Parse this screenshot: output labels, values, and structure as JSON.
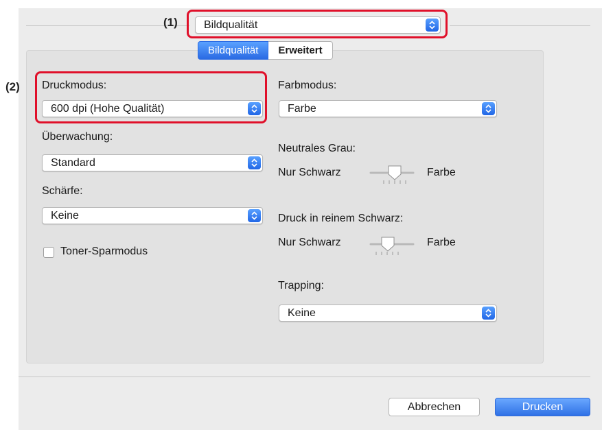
{
  "callouts": {
    "one": "(1)",
    "two": "(2)"
  },
  "panel_selector": {
    "value": "Bildqualität"
  },
  "tabs": [
    {
      "label": "Bildqualität",
      "active": true
    },
    {
      "label": "Erweitert",
      "active": false
    }
  ],
  "left": {
    "druckmodus_label": "Druckmodus:",
    "druckmodus_value": "600 dpi (Hohe Qualität)",
    "ueberwachung_label": "Überwachung:",
    "ueberwachung_value": "Standard",
    "schaerfe_label": "Schärfe:",
    "schaerfe_value": "Keine",
    "toner_label": "Toner-Sparmodus",
    "toner_checked": false
  },
  "right": {
    "farbmodus_label": "Farbmodus:",
    "farbmodus_value": "Farbe",
    "neutral_label": "Neutrales Grau:",
    "neutral_left": "Nur Schwarz",
    "neutral_right": "Farbe",
    "neutral_level": 0.5,
    "pure_label": "Druck in reinem Schwarz:",
    "pure_left": "Nur Schwarz",
    "pure_right": "Farbe",
    "pure_level": 0.5,
    "trapping_label": "Trapping:",
    "trapping_value": "Keine"
  },
  "buttons": {
    "cancel": "Abbrechen",
    "print": "Drucken"
  },
  "colors": {
    "accent": "#2a6ae3",
    "callout_box": "#e0102a",
    "window_bg": "#ececec"
  }
}
